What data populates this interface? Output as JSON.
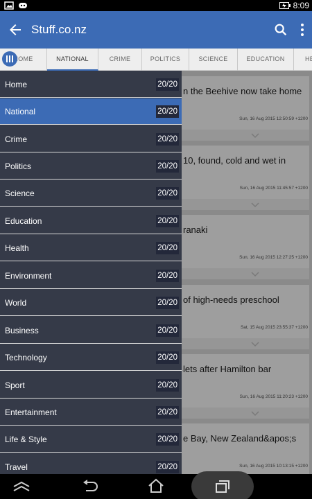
{
  "status_bar": {
    "time": "8:09",
    "icons": [
      "image-icon",
      "notification-icon",
      "battery-charging-icon"
    ]
  },
  "app_bar": {
    "title": "Stuff.co.nz",
    "icons": [
      "back-arrow-icon",
      "search-icon",
      "more-vert-icon"
    ]
  },
  "tabs": [
    {
      "label": "HOME"
    },
    {
      "label": "NATIONAL",
      "selected": true
    },
    {
      "label": "CRIME"
    },
    {
      "label": "POLITICS"
    },
    {
      "label": "SCIENCE"
    },
    {
      "label": "EDUCATION"
    },
    {
      "label": "HE"
    }
  ],
  "drawer": {
    "items": [
      {
        "label": "Home",
        "count": "20/20"
      },
      {
        "label": "National",
        "count": "20/20",
        "selected": true
      },
      {
        "label": "Crime",
        "count": "20/20"
      },
      {
        "label": "Politics",
        "count": "20/20"
      },
      {
        "label": "Science",
        "count": "20/20"
      },
      {
        "label": "Education",
        "count": "20/20"
      },
      {
        "label": "Health",
        "count": "20/20"
      },
      {
        "label": "Environment",
        "count": "20/20"
      },
      {
        "label": "World",
        "count": "20/20"
      },
      {
        "label": "Business",
        "count": "20/20"
      },
      {
        "label": "Technology",
        "count": "20/20"
      },
      {
        "label": "Sport",
        "count": "20/20"
      },
      {
        "label": "Entertainment",
        "count": "20/20"
      },
      {
        "label": "Life & Style",
        "count": "20/20"
      },
      {
        "label": "Travel",
        "count": "20/20"
      }
    ]
  },
  "articles": [
    {
      "headline": "n the Beehive now take home",
      "date": "Sun, 16 Aug 2015 12:50:59 +1200"
    },
    {
      "headline": "10, found, cold and wet in",
      "date": "Sun, 16 Aug 2015 11:45:57 +1200"
    },
    {
      "headline": "ranaki",
      "date": "Sun, 16 Aug 2015 12:27:25 +1200"
    },
    {
      "headline": "of high-needs preschool",
      "date": "Sat, 15 Aug 2015 23:55:37 +1200"
    },
    {
      "headline": "lets after Hamilton bar",
      "date": "Sun, 16 Aug 2015 11:20:23 +1200"
    },
    {
      "headline": "e Bay, New Zealand&apos;s",
      "date": "Sun, 16 Aug 2015 10:13:15 +1200"
    }
  ],
  "nav_bar": {
    "icons": [
      "back-nav-icon",
      "home-nav-icon",
      "recents-nav-icon",
      "collapse-icon"
    ]
  },
  "colors": {
    "accent": "#3c6bb5",
    "drawer_bg": "#353a48",
    "badge_bg": "#23283a"
  }
}
